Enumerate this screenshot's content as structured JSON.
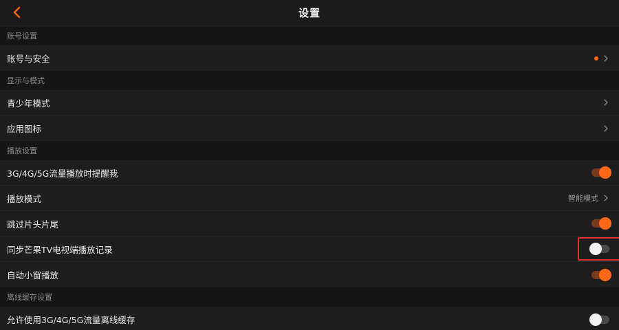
{
  "header": {
    "title": "设置"
  },
  "sections": [
    {
      "title": "账号设置",
      "rows": [
        {
          "label": "账号与安全",
          "type": "link",
          "dot": true
        }
      ]
    },
    {
      "title": "显示与模式",
      "rows": [
        {
          "label": "青少年模式",
          "type": "link"
        },
        {
          "label": "应用图标",
          "type": "link"
        }
      ]
    },
    {
      "title": "播放设置",
      "rows": [
        {
          "label": "3G/4G/5G流量播放时提醒我",
          "type": "toggle",
          "on": true
        },
        {
          "label": "播放模式",
          "type": "link",
          "value": "智能模式"
        },
        {
          "label": "跳过片头片尾",
          "type": "toggle",
          "on": true
        },
        {
          "label": "同步芒果TV电视端播放记录",
          "type": "toggle",
          "on": false,
          "highlighted": true
        },
        {
          "label": "自动小窗播放",
          "type": "toggle",
          "on": true
        }
      ]
    },
    {
      "title": "离线缓存设置",
      "rows": [
        {
          "label": "允许使用3G/4G/5G流量离线缓存",
          "type": "toggle",
          "on": false
        }
      ]
    }
  ],
  "colors": {
    "accent": "#ff6a1a",
    "highlight": "#e0332c",
    "background": "#161616",
    "row_background": "#1e1e1e"
  },
  "icons": {
    "back": "chevron-left-icon",
    "disclosure": "chevron-right-icon"
  }
}
